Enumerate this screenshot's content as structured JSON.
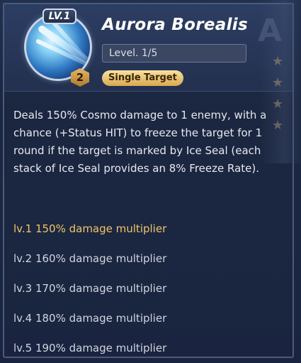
{
  "skill": {
    "icon_level_tag": "LV.1",
    "badge_number": "2",
    "name": "Aurora Borealis",
    "level_text": "Level. 1/5",
    "target_type": "Single Target",
    "description": "Deals 150% Cosmo damage to 1 enemy, with a chance (+Status HIT) to freeze the target for 1 round if the target is marked by Ice Seal (each stack of Ice Seal provides an 8% Freeze Rate)."
  },
  "levels": [
    {
      "label": "lv.1 150% damage multiplier",
      "current": true
    },
    {
      "label": "lv.2 160% damage multiplier",
      "current": false
    },
    {
      "label": "lv.3 170% damage multiplier",
      "current": false
    },
    {
      "label": "lv.4 180% damage multiplier",
      "current": false
    },
    {
      "label": "lv.5 190% damage multiplier",
      "current": false
    }
  ],
  "colors": {
    "current_level": "#f0c36b",
    "other_level": "#cfd4de",
    "target_pill": "#e8c275"
  },
  "icons": {
    "skill_icon": "aurora-beam-icon",
    "badge_icon": "hexagon-badge-icon"
  }
}
